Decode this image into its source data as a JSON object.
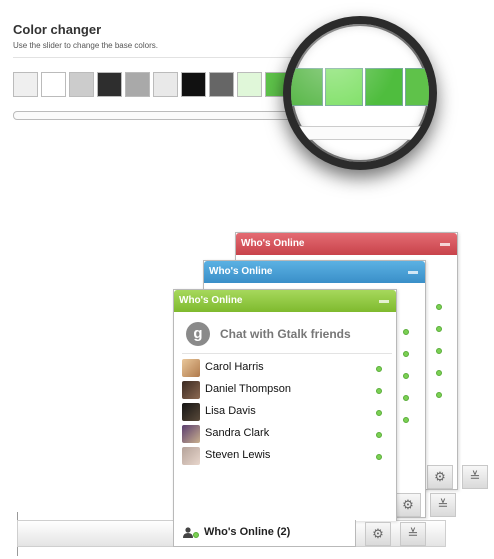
{
  "header": {
    "title": "Color changer",
    "subtitle": "Use the slider to change the base colors."
  },
  "swatches": [
    "#efefef",
    "#ffffff",
    "#cccccc",
    "#2e2e2e",
    "#a9a9a9",
    "#e9e9e9",
    "#111111",
    "#666666",
    "#e0f7d9",
    "#5ec34a",
    "#7ad060"
  ],
  "magnified_swatches": [
    "#5ab84a",
    "#7fe066",
    "#4fbd3e",
    "#5fc24a"
  ],
  "panels": [
    {
      "title": "Who's Online",
      "color": "red"
    },
    {
      "title": "Who's Online",
      "color": "blue"
    },
    {
      "title": "Who's Online",
      "color": "green"
    }
  ],
  "gtalk": {
    "label": "Chat with Gtalk friends",
    "icon": "g"
  },
  "contacts": [
    {
      "name": "Carol Harris",
      "status": "online"
    },
    {
      "name": "Daniel Thompson",
      "status": "online"
    },
    {
      "name": "Lisa Davis",
      "status": "online"
    },
    {
      "name": "Sandra Clark",
      "status": "online"
    },
    {
      "name": "Steven Lewis",
      "status": "online"
    }
  ],
  "bottom_bar": {
    "online_label": "Who's Online (2)",
    "settings_icon": "gear-icon",
    "collapse_icon": "double-chevron-down-icon"
  },
  "colors": {
    "online": "#7bd053",
    "red_head": "#c8434b",
    "blue_head": "#3a8fc8",
    "green_head": "#7fba2e"
  }
}
